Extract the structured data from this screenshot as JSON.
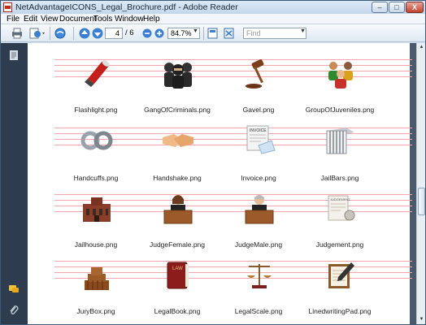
{
  "window": {
    "title": "NetAdvantageICONS_Legal_Brochure.pdf - Adobe Reader",
    "min_label": "–",
    "max_label": "□",
    "close_label": "X"
  },
  "menu": [
    "File",
    "Edit",
    "View",
    "Document",
    "Tools",
    "Window",
    "Help"
  ],
  "toolbar": {
    "page_current": "4",
    "page_total": "/ 6",
    "zoom_value": "84.7%",
    "find_placeholder": "Find"
  },
  "icons": [
    {
      "label": "Flashlight.png",
      "icon": "flashlight-icon"
    },
    {
      "label": "GangOfCriminals.png",
      "icon": "criminals-icon"
    },
    {
      "label": "Gavel.png",
      "icon": "gavel-icon"
    },
    {
      "label": "GroupOfJuveniles.png",
      "icon": "juveniles-icon"
    },
    {
      "label": "Handcuffs.png",
      "icon": "handcuffs-icon"
    },
    {
      "label": "Handshake.png",
      "icon": "handshake-icon"
    },
    {
      "label": "Invoice.png",
      "icon": "invoice-icon"
    },
    {
      "label": "JailBars.png",
      "icon": "jailbars-icon"
    },
    {
      "label": "Jailhouse.png",
      "icon": "jailhouse-icon"
    },
    {
      "label": "JudgeFemale.png",
      "icon": "judge-female-icon"
    },
    {
      "label": "JudgeMale.png",
      "icon": "judge-male-icon"
    },
    {
      "label": "Judgement.png",
      "icon": "judgement-icon"
    },
    {
      "label": "JuryBox.png",
      "icon": "jurybox-icon"
    },
    {
      "label": "LegalBook.png",
      "icon": "legalbook-icon"
    },
    {
      "label": "LegalScale.png",
      "icon": "legalscale-icon"
    },
    {
      "label": "LinedwritingPad.png",
      "icon": "writingpad-icon"
    }
  ],
  "icon_text": {
    "invoice_header": "INVOICE",
    "law_text": "LAW",
    "judgement_header": "JUDGEMENT"
  }
}
